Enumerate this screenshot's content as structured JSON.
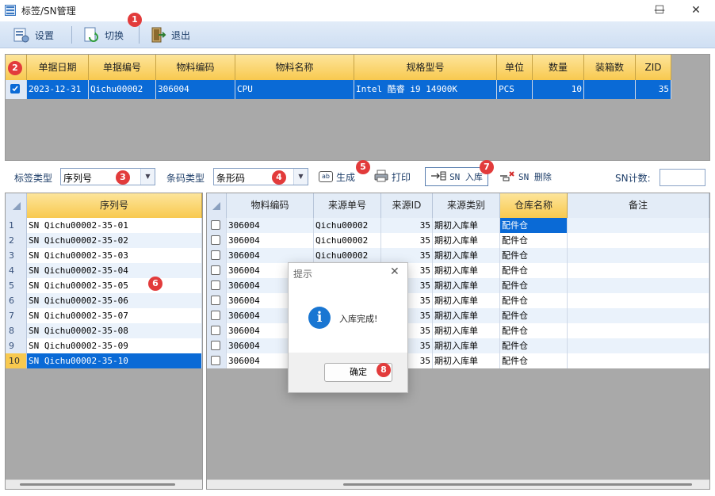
{
  "window": {
    "title": "标签/SN管理",
    "min": "—",
    "max": "☐",
    "close": "✕"
  },
  "toolbar": {
    "settings": "设置",
    "switch": "切换",
    "exit": "退出"
  },
  "order_grid": {
    "headers": [
      "单据日期",
      "单据编号",
      "物料编码",
      "物料名称",
      "规格型号",
      "单位",
      "数量",
      "装箱数",
      "ZID"
    ],
    "row": {
      "date": "2023-12-31",
      "doc_no": "Qichu00002",
      "material_code": "306004",
      "material_name": "CPU",
      "spec": "Intel 酷睿 i9 14900K",
      "unit": "PCS",
      "qty": "10",
      "box_qty": "",
      "zid": "35"
    }
  },
  "filter": {
    "label_type_label": "标签类型",
    "label_type_value": "序列号",
    "barcode_type_label": "条码类型",
    "barcode_type_value": "条形码",
    "generate": "生成",
    "print": "打印",
    "sn_in": "SN 入库",
    "sn_delete": "SN 删除",
    "sn_count_label": "SN计数:",
    "sn_count_value": ""
  },
  "serial_grid": {
    "header": "序列号",
    "rows": [
      {
        "n": "1",
        "sn": "SN Qichu00002-35-01"
      },
      {
        "n": "2",
        "sn": "SN Qichu00002-35-02"
      },
      {
        "n": "3",
        "sn": "SN Qichu00002-35-03"
      },
      {
        "n": "4",
        "sn": "SN Qichu00002-35-04"
      },
      {
        "n": "5",
        "sn": "SN Qichu00002-35-05"
      },
      {
        "n": "6",
        "sn": "SN Qichu00002-35-06"
      },
      {
        "n": "7",
        "sn": "SN Qichu00002-35-07"
      },
      {
        "n": "8",
        "sn": "SN Qichu00002-35-08"
      },
      {
        "n": "9",
        "sn": "SN Qichu00002-35-09"
      },
      {
        "n": "10",
        "sn": "SN Qichu00002-35-10"
      }
    ]
  },
  "detail_grid": {
    "headers": [
      "物料编码",
      "来源单号",
      "来源ID",
      "来源类别",
      "仓库名称",
      "备注"
    ],
    "rows": [
      {
        "code": "306004",
        "src_no": "Qichu00002",
        "src_id": "35",
        "src_type": "期初入库单",
        "wh": "配件仓",
        "note": ""
      },
      {
        "code": "306004",
        "src_no": "Qichu00002",
        "src_id": "35",
        "src_type": "期初入库单",
        "wh": "配件仓",
        "note": ""
      },
      {
        "code": "306004",
        "src_no": "Qichu00002",
        "src_id": "35",
        "src_type": "期初入库单",
        "wh": "配件仓",
        "note": ""
      },
      {
        "code": "306004",
        "src_no": "",
        "src_id": "35",
        "src_type": "期初入库单",
        "wh": "配件仓",
        "note": ""
      },
      {
        "code": "306004",
        "src_no": "",
        "src_id": "35",
        "src_type": "期初入库单",
        "wh": "配件仓",
        "note": ""
      },
      {
        "code": "306004",
        "src_no": "",
        "src_id": "35",
        "src_type": "期初入库单",
        "wh": "配件仓",
        "note": ""
      },
      {
        "code": "306004",
        "src_no": "",
        "src_id": "35",
        "src_type": "期初入库单",
        "wh": "配件仓",
        "note": ""
      },
      {
        "code": "306004",
        "src_no": "",
        "src_id": "35",
        "src_type": "期初入库单",
        "wh": "配件仓",
        "note": ""
      },
      {
        "code": "306004",
        "src_no": "",
        "src_id": "35",
        "src_type": "期初入库单",
        "wh": "配件仓",
        "note": ""
      },
      {
        "code": "306004",
        "src_no": "",
        "src_id": "35",
        "src_type": "期初入库单",
        "wh": "配件仓",
        "note": ""
      }
    ]
  },
  "dialog": {
    "title": "提示",
    "message": "入库完成!",
    "ok": "确定",
    "info_glyph": "i",
    "close": "✕"
  },
  "badges": [
    "1",
    "2",
    "3",
    "4",
    "5",
    "6",
    "7",
    "8"
  ],
  "colors": {
    "header_gold": "#f8c94f",
    "selection_blue": "#0a6ad6",
    "badge_red": "#e23b3b"
  }
}
